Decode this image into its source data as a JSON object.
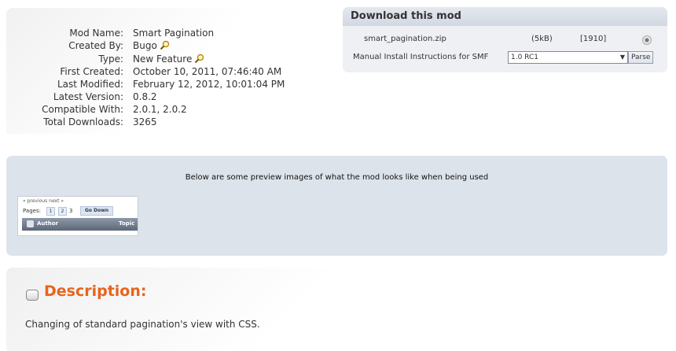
{
  "mod_info": [
    {
      "label": "Mod Name:",
      "value": "Smart Pagination"
    },
    {
      "label": "Created By:",
      "value": "Bugo"
    },
    {
      "label": "Type:",
      "value": "New Feature"
    },
    {
      "label": "First Created:",
      "value": "October 10, 2011, 07:46:40 AM"
    },
    {
      "label": "Last Modified:",
      "value": "February 12, 2012, 10:01:04 PM"
    },
    {
      "label": "Latest Version:",
      "value": "0.8.2"
    },
    {
      "label": "Compatible With:",
      "value": "2.0.1, 2.0.2"
    },
    {
      "label": "Total Downloads:",
      "value": "3265"
    }
  ],
  "download": {
    "title": "Download this mod",
    "file_name": "smart_pagination.zip",
    "file_size": "(5kB)",
    "download_count": "[1910]",
    "manual_label": "Manual Install Instructions for SMF",
    "version_selected": "1.0 RC1",
    "parse_label": "Parse"
  },
  "preview": {
    "caption": "Below are some preview images of what the mod looks like when being used",
    "thumb": {
      "prevnext": "« previous next »",
      "pages_label": "Pages:",
      "page_1": "1",
      "page_2": "2",
      "page_3": "3",
      "go_down": "Go Down",
      "author": "Author",
      "topic": "Topic"
    }
  },
  "description": {
    "title": "Description:",
    "text": "Changing of standard pagination's view with CSS."
  },
  "colors": {
    "accent": "#e8641b",
    "download_header": "#d2d8e2",
    "preview_bg": "#dde3ea"
  }
}
